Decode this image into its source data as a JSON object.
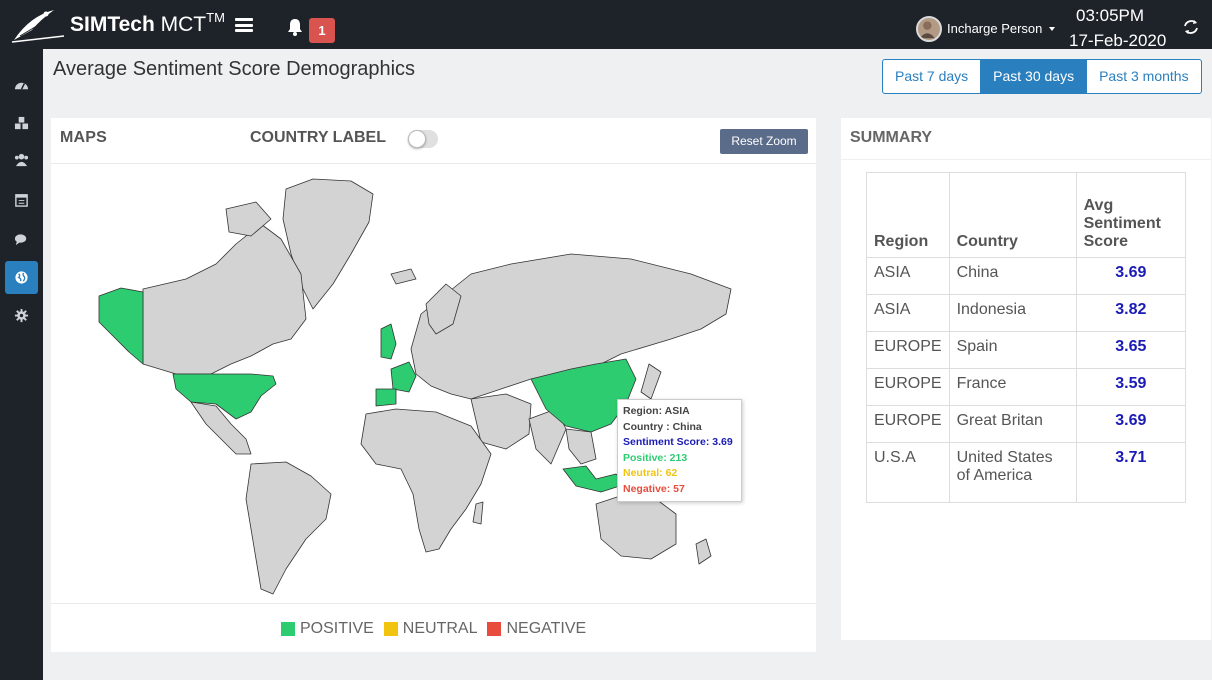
{
  "header": {
    "brand_bold": "SIMTech",
    "brand_light": " MCT",
    "brand_sup": "TM",
    "notification_count": "1",
    "user_name": "Incharge Person",
    "time": "03:05PM",
    "date": "17-Feb-2020"
  },
  "sidebar": {
    "items": [
      {
        "icon": "dashboard-icon"
      },
      {
        "icon": "cubes-icon"
      },
      {
        "icon": "users-icon"
      },
      {
        "icon": "calendar-icon"
      },
      {
        "icon": "comments-icon"
      },
      {
        "icon": "globe-icon",
        "active": true
      },
      {
        "icon": "gear-icon"
      }
    ]
  },
  "page": {
    "title": "Average Sentiment Score Demographics",
    "ranges": [
      "Past 7 days",
      "Past 30 days",
      "Past 3 months"
    ],
    "active_range": "Past 30 days"
  },
  "maps": {
    "title": "MAPS",
    "country_label": "COUNTRY LABEL",
    "reset_zoom": "Reset Zoom",
    "tooltip": {
      "region": "Region: ASIA",
      "country": "Country : China",
      "score": "Sentiment Score: 3.69",
      "positive": "Positive: 213",
      "neutral": "Neutral: 62",
      "negative": "Negative: 57"
    },
    "legend": [
      {
        "label": "POSITIVE",
        "color": "#2ecc71"
      },
      {
        "label": "NEUTRAL",
        "color": "#f1c40f"
      },
      {
        "label": "NEGATIVE",
        "color": "#e74c3c"
      }
    ]
  },
  "summary": {
    "title": "SUMMARY",
    "columns": [
      "Region",
      "Country",
      "Avg Sentiment Score"
    ],
    "rows": [
      {
        "region": "ASIA",
        "country": "China",
        "score": "3.69"
      },
      {
        "region": "ASIA",
        "country": "Indonesia",
        "score": "3.82"
      },
      {
        "region": "EUROPE",
        "country": "Spain",
        "score": "3.65"
      },
      {
        "region": "EUROPE",
        "country": "France",
        "score": "3.59"
      },
      {
        "region": "EUROPE",
        "country": "Great Britan",
        "score": "3.69"
      },
      {
        "region": "U.S.A",
        "country": "United States of America",
        "score": "3.71"
      }
    ]
  },
  "colors": {
    "positive": "#2ecc71",
    "land": "#d3d3d3",
    "accent": "#2a7fbf",
    "score": "#1b1bb5"
  }
}
